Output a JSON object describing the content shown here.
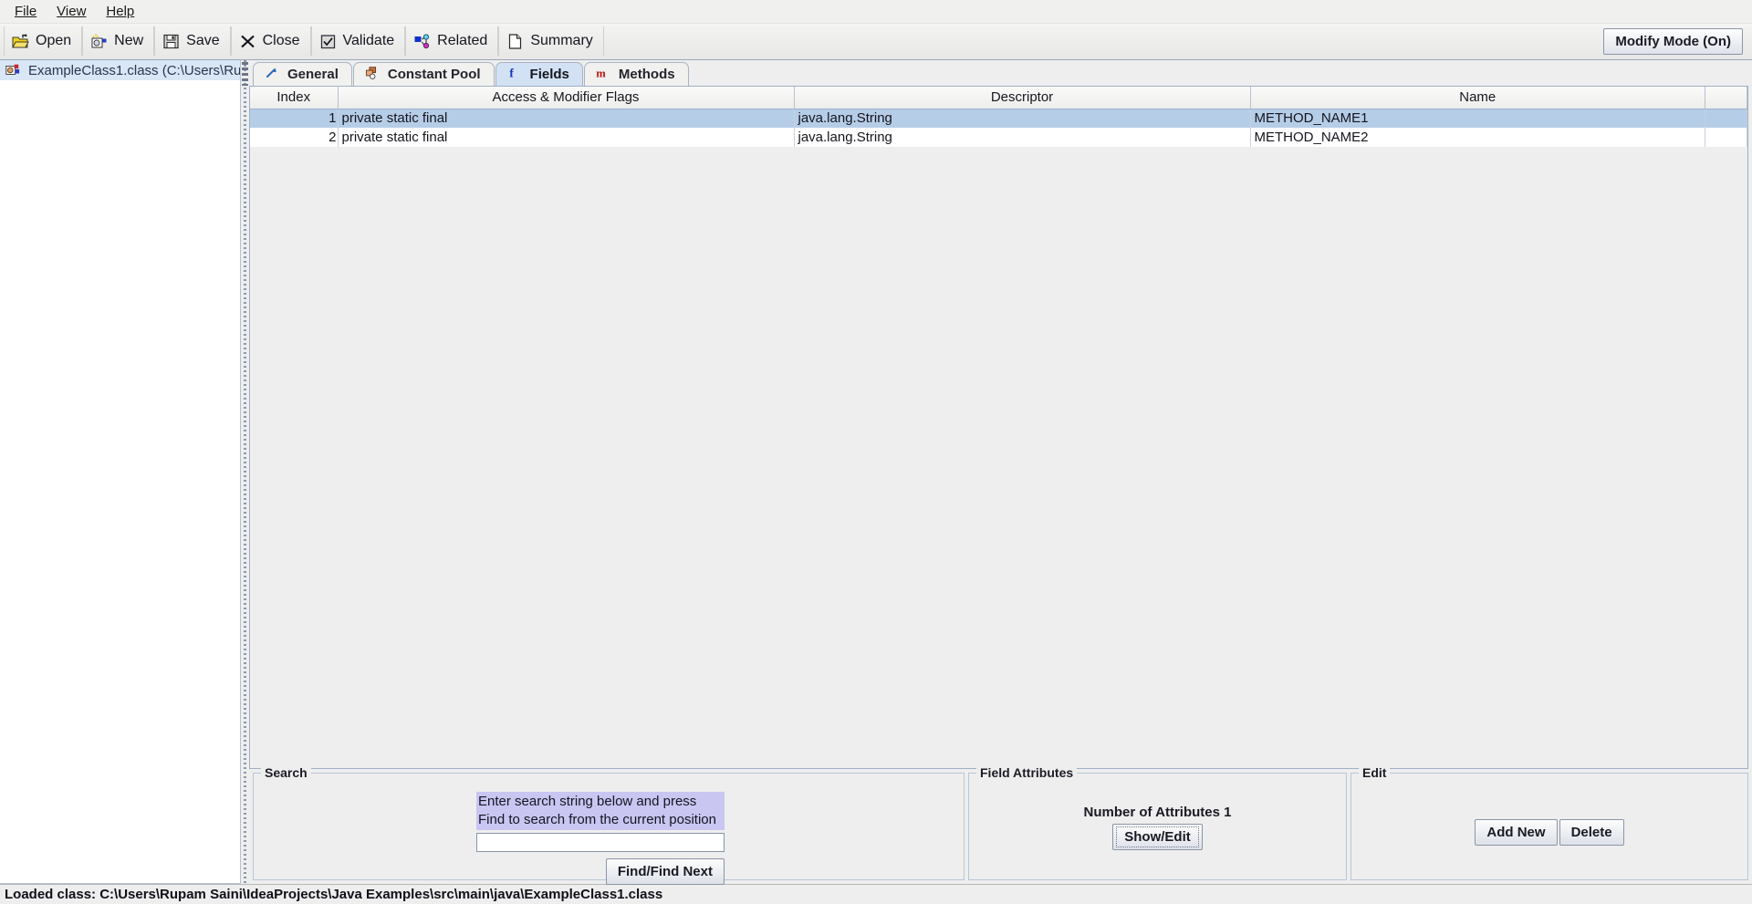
{
  "menubar": {
    "items": [
      {
        "label": "File",
        "accel": "F"
      },
      {
        "label": "View",
        "accel": "V"
      },
      {
        "label": "Help",
        "accel": "H"
      }
    ]
  },
  "toolbar": {
    "buttons": [
      {
        "label": "Open",
        "icon": "open-folder-icon"
      },
      {
        "label": "New",
        "icon": "new-class-icon"
      },
      {
        "label": "Save",
        "icon": "floppy-disk-icon"
      },
      {
        "label": "Close",
        "icon": "close-x-icon"
      },
      {
        "label": "Validate",
        "icon": "checkbox-check-icon"
      },
      {
        "label": "Related",
        "icon": "related-nodes-icon"
      },
      {
        "label": "Summary",
        "icon": "document-page-icon"
      }
    ],
    "modify_mode_label": "Modify Mode (On)"
  },
  "tree": {
    "items": [
      {
        "label": "ExampleClass1.class (C:\\Users\\Ru",
        "icon": "class-file-icon",
        "selected": true
      }
    ]
  },
  "tabs": [
    {
      "label": "General",
      "icon": "arrow-up-right-icon",
      "selected": false
    },
    {
      "label": "Constant Pool",
      "icon": "constant-pool-icon",
      "selected": false
    },
    {
      "label": "Fields",
      "icon": "field-f-icon",
      "selected": true
    },
    {
      "label": "Methods",
      "icon": "method-m-icon",
      "selected": false
    }
  ],
  "table": {
    "columns": [
      "Index",
      "Access & Modifier Flags",
      "Descriptor",
      "Name"
    ],
    "rows": [
      {
        "index": "1",
        "flags": "private static final",
        "descriptor": "java.lang.String",
        "name": "METHOD_NAME1",
        "selected": true
      },
      {
        "index": "2",
        "flags": "private static final",
        "descriptor": "java.lang.String",
        "name": "METHOD_NAME2",
        "selected": false
      }
    ]
  },
  "search_panel": {
    "title": "Search",
    "tooltip": "Enter search string below and press Find to search from the current position",
    "input_value": "",
    "input_placeholder": "",
    "find_button": "Find/Find Next"
  },
  "field_attributes_panel": {
    "title": "Field Attributes",
    "count_label": "Number of Attributes 1",
    "show_edit_button": "Show/Edit"
  },
  "edit_panel": {
    "title": "Edit",
    "add_button": "Add New",
    "delete_button": "Delete"
  },
  "statusbar": {
    "text": "Loaded class: C:\\Users\\Rupam Saini\\IdeaProjects\\Java Examples\\src\\main\\java\\ExampleClass1.class"
  },
  "colors": {
    "selection_blue": "#b6cde8",
    "tab_selected": "#d2e2f4",
    "tooltip_lavender": "#c9c6f2",
    "panel_gray": "#eeeeee"
  }
}
